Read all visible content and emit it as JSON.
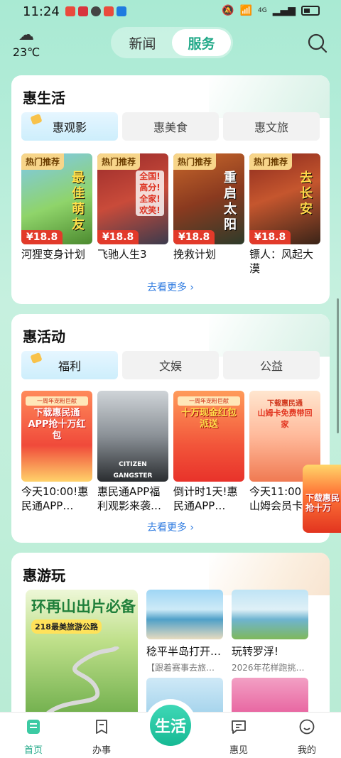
{
  "status_bar": {
    "time": "11:24",
    "network": "4G"
  },
  "header": {
    "temperature": "23℃",
    "tabs": [
      {
        "label": "新闻",
        "active": false
      },
      {
        "label": "服务",
        "active": true
      }
    ]
  },
  "benefit_life": {
    "title": "惠生活",
    "tabs": [
      {
        "label": "惠观影"
      },
      {
        "label": "惠美食"
      },
      {
        "label": "惠文旅"
      }
    ],
    "items": [
      {
        "badge": "热门推荐",
        "price": "¥18.8",
        "title": "河狸变身计划",
        "poster_text": "最佳萌友"
      },
      {
        "badge": "热门推荐",
        "price": "¥18.8",
        "title": "飞驰人生3",
        "poster_text": "全国!高分!全家!欢笑!"
      },
      {
        "badge": "热门推荐",
        "price": "¥18.8",
        "title": "挽救计划",
        "poster_text": "重启太阳"
      },
      {
        "badge": "热门推荐",
        "price": "¥18.8",
        "title": "镖人：风起大漠",
        "poster_text": "去长安"
      }
    ],
    "more": "去看更多 ›"
  },
  "benefit_activity": {
    "title": "惠活动",
    "tabs": [
      {
        "label": "福利"
      },
      {
        "label": "文娱"
      },
      {
        "label": "公益"
      }
    ],
    "items": [
      {
        "title": "今天10:00!惠民通APP…",
        "head": "一周年宠粉巨献",
        "big": "下载惠民通APP抢十万红包"
      },
      {
        "title": "惠民通APP福利观影来袭…",
        "head": "",
        "big": "CITIZEN GANGSTER"
      },
      {
        "title": "倒计时1天!惠民通APP…",
        "head": "一周年宠粉巨献",
        "big": "十万现金红包派送"
      },
      {
        "title": "今天11:00，山姆会员卡…",
        "head": "下载惠民通",
        "big": "山姆卡免费带回家"
      }
    ],
    "more": "去看更多 ›",
    "floating_ad": "下载惠民抢十万"
  },
  "benefit_travel": {
    "title": "惠游玩",
    "feature": {
      "title": "环再山出片必备",
      "subtitle": "218最美旅游公路"
    },
    "items": [
      {
        "title": "稔平半岛打开…",
        "subtitle": "【跟着赛事去旅…"
      },
      {
        "title": "玩转罗浮!",
        "subtitle": "2026年花样跑挑…"
      }
    ]
  },
  "bottom_nav": {
    "items": [
      {
        "label": "首页",
        "active": true
      },
      {
        "label": "办事",
        "active": false
      },
      {
        "label": "惠见",
        "active": false
      },
      {
        "label": "我的",
        "active": false
      }
    ],
    "center_label": "生活"
  }
}
